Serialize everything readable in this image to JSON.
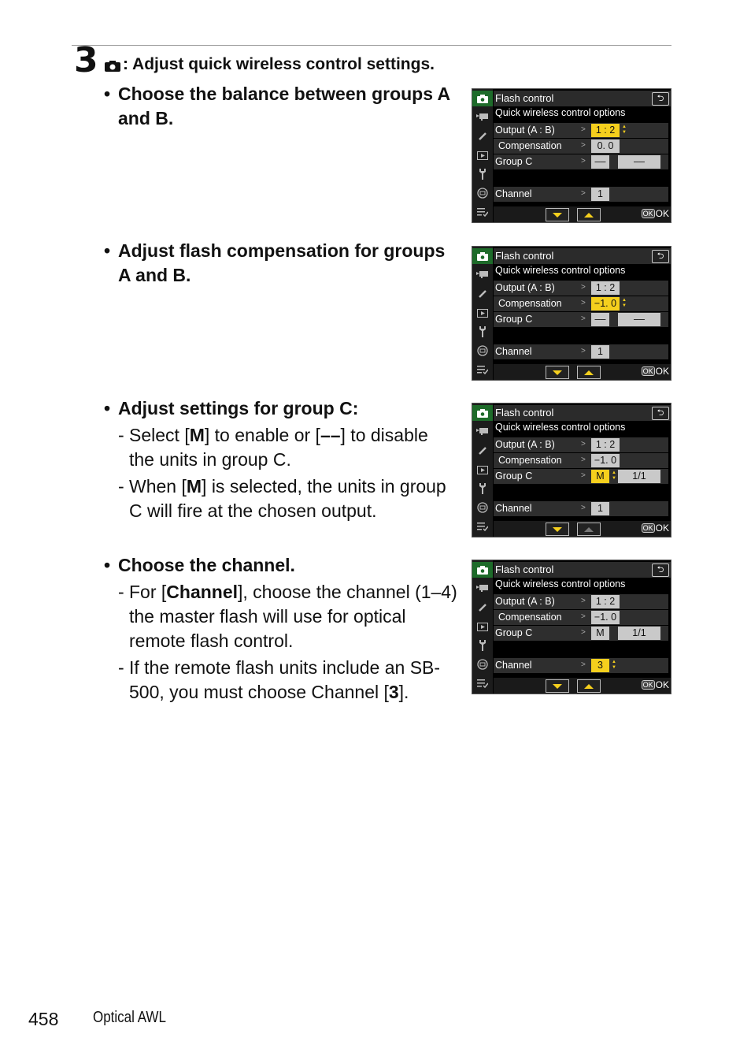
{
  "step": {
    "number": "3",
    "icon": "camera-icon",
    "title": ": Adjust quick wireless control settings."
  },
  "sections": [
    {
      "bullet": "Choose the balance between groups A and B.",
      "subs": []
    },
    {
      "bullet": "Adjust flash compensation for groups A and B.",
      "subs": []
    },
    {
      "bullet": "Adjust settings for group C:",
      "subs": [
        {
          "pre": "Select [",
          "bold": "M",
          "post": "] to enable or [",
          "bold2": "––",
          "post2": "] to disable the units in group C."
        },
        {
          "pre": "When [",
          "bold": "M",
          "post": "] is selected, the units in group C will fire at the chosen output.",
          "bold2": "",
          "post2": ""
        }
      ]
    },
    {
      "bullet": "Choose the channel.",
      "subs": [
        {
          "pre": "For [",
          "bold": "Channel",
          "post": "], choose the channel (1–4) the master flash will use for optical remote flash control.",
          "bold2": "",
          "post2": ""
        },
        {
          "pre": "If the remote flash units include an SB-500, you must choose Channel [",
          "bold": "3",
          "post": "].",
          "bold2": "",
          "post2": ""
        }
      ]
    }
  ],
  "screens": [
    {
      "title": "Flash control",
      "subtitle": "Quick wireless control options",
      "rows": {
        "output_label": "Output (A : B)",
        "output_value": "1 : 2",
        "comp_label": "Compensation",
        "comp_value": "0. 0",
        "groupc_label": "Group C",
        "groupc_mode": "––",
        "groupc_output": "––",
        "channel_label": "Channel",
        "channel_value": "1"
      },
      "selected": "output",
      "ok_label": "OK"
    },
    {
      "title": "Flash control",
      "subtitle": "Quick wireless control options",
      "rows": {
        "output_label": "Output (A : B)",
        "output_value": "1 : 2",
        "comp_label": "Compensation",
        "comp_value": "−1. 0",
        "groupc_label": "Group C",
        "groupc_mode": "––",
        "groupc_output": "––",
        "channel_label": "Channel",
        "channel_value": "1"
      },
      "selected": "comp",
      "ok_label": "OK"
    },
    {
      "title": "Flash control",
      "subtitle": "Quick wireless control options",
      "rows": {
        "output_label": "Output (A : B)",
        "output_value": "1 : 2",
        "comp_label": "Compensation",
        "comp_value": "−1. 0",
        "groupc_label": "Group C",
        "groupc_mode": "M",
        "groupc_output": "1/1",
        "channel_label": "Channel",
        "channel_value": "1"
      },
      "selected": "groupc",
      "ok_label": "OK"
    },
    {
      "title": "Flash control",
      "subtitle": "Quick wireless control options",
      "rows": {
        "output_label": "Output (A : B)",
        "output_value": "1 : 2",
        "comp_label": "Compensation",
        "comp_value": "−1. 0",
        "groupc_label": "Group C",
        "groupc_mode": "M",
        "groupc_output": "1/1",
        "channel_label": "Channel",
        "channel_value": "3"
      },
      "selected": "channel",
      "ok_label": "OK"
    }
  ],
  "footer": {
    "page_number": "458",
    "section_name": "Optical AWL"
  },
  "colors": {
    "highlight": "#f5cf1d",
    "active_tab": "#1e6b2a",
    "value_box": "#c9c9c9"
  }
}
